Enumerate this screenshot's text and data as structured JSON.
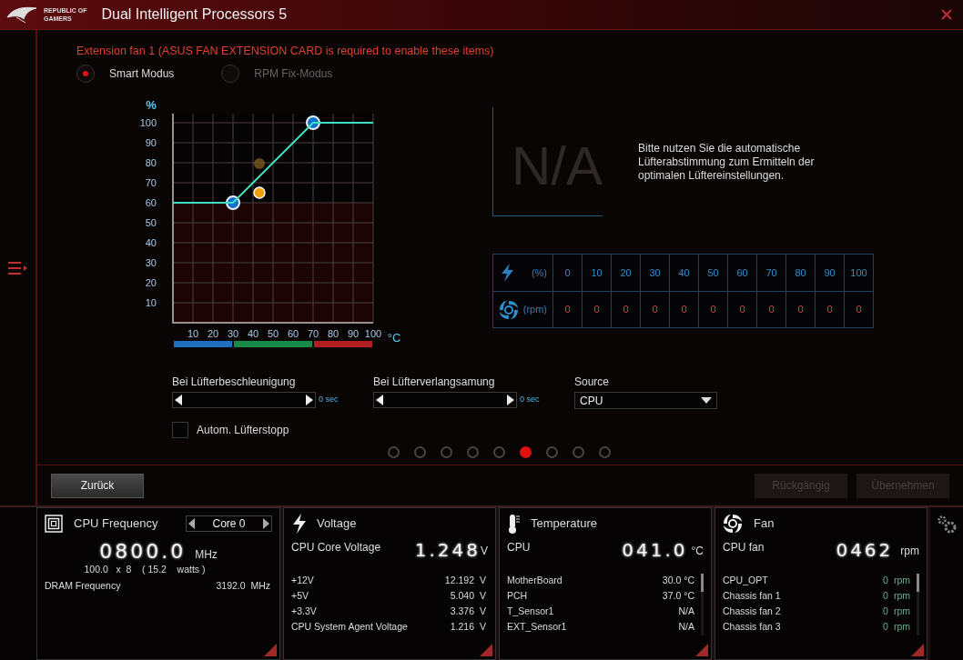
{
  "window": {
    "logo_lines": [
      "REPUBLIC OF",
      "GAMERS"
    ],
    "title": "Dual Intelligent Processors 5"
  },
  "notice": "Extension fan 1 (ASUS FAN EXTENSION CARD is required to enable these items)",
  "modes": [
    {
      "label": "Smart Modus",
      "selected": true,
      "disabled": false
    },
    {
      "label": "RPM Fix-Modus",
      "selected": false,
      "disabled": true
    }
  ],
  "fan_curve": {
    "chart_data": {
      "type": "line",
      "xlabel": "°C",
      "ylabel": "%",
      "x": [
        0,
        30,
        70,
        100
      ],
      "series": [
        {
          "color": "#3fe0c0",
          "values": [
            60,
            60,
            100,
            100
          ]
        }
      ],
      "xlim": [
        0,
        100
      ],
      "ylim": [
        0,
        100
      ],
      "xticks": [
        10,
        20,
        30,
        40,
        50,
        60,
        70,
        80,
        90,
        100
      ],
      "yticks": [
        10,
        20,
        30,
        40,
        50,
        60,
        70,
        80,
        90,
        100
      ],
      "grid": true,
      "bands": [
        {
          "axis": "y",
          "from": 0,
          "to": 60,
          "color": "#1c0404"
        }
      ]
    }
  },
  "tuning": {
    "reading": "N/A",
    "message": "Bitte nutzen Sie die automatische Lüfterabstimmung zum Ermitteln der optimalen Lüftereinstellungen."
  },
  "table": {
    "rows": [
      {
        "kind": "power",
        "unit": "(%)",
        "values": [
          "0",
          "10",
          "20",
          "30",
          "40",
          "50",
          "60",
          "70",
          "80",
          "90",
          "100"
        ]
      },
      {
        "kind": "fan",
        "unit": "(rpm)",
        "values": [
          "0",
          "0",
          "0",
          "0",
          "0",
          "0",
          "0",
          "0",
          "0",
          "0",
          "0"
        ]
      }
    ]
  },
  "sliders": [
    {
      "label": "Bei Lüfterbeschleunigung",
      "reading": "0 sec"
    },
    {
      "label": "Bei Lüfterverlangsamung",
      "reading": "0 sec"
    }
  ],
  "source": {
    "label": "Source",
    "value": "CPU"
  },
  "autostop": {
    "label": "Autom. Lüfterstopp",
    "checked": false
  },
  "pages": [
    {
      "selected": false
    },
    {
      "selected": false
    },
    {
      "selected": false
    },
    {
      "selected": false
    },
    {
      "selected": false
    },
    {
      "selected": true
    },
    {
      "selected": false
    },
    {
      "selected": false
    },
    {
      "selected": false
    }
  ],
  "buttons": [
    {
      "label": "Zurück",
      "disabled": false
    },
    {
      "label": "Rückgängig",
      "disabled": true
    },
    {
      "label": "Übernehmen",
      "disabled": true
    }
  ],
  "monitor": {
    "cpu_frequency": {
      "title": "CPU Frequency",
      "core": "Core 0",
      "value": "0800.0",
      "unit": "MHz",
      "detail": "100.0   x  8    ( 15.2    watts )",
      "dram_label": "DRAM Frequency",
      "dram_value": "3192.0  MHz"
    },
    "voltage": {
      "title": "Voltage",
      "main_label": "CPU Core Voltage",
      "value": "1.248",
      "unit": "V",
      "rows": [
        {
          "label": "+12V",
          "value": "12.192",
          "unit": "V"
        },
        {
          "label": "+5V",
          "value": "5.040",
          "unit": "V"
        },
        {
          "label": "+3.3V",
          "value": "3.376",
          "unit": "V"
        },
        {
          "label": "CPU System Agent Voltage",
          "value": "1.216",
          "unit": "V"
        }
      ]
    },
    "temperature": {
      "title": "Temperature",
      "main_label": "CPU",
      "value": "041.0",
      "unit": "°C",
      "rows": [
        {
          "label": "MotherBoard",
          "value": "30.0 °C"
        },
        {
          "label": "PCH",
          "value": "37.0 °C"
        },
        {
          "label": "T_Sensor1",
          "value": "N/A"
        },
        {
          "label": "EXT_Sensor1",
          "value": "N/A"
        }
      ]
    },
    "fan": {
      "title": "Fan",
      "main_label": "CPU fan",
      "value": "0462",
      "unit": "rpm",
      "rows": [
        {
          "label": "CPU_OPT",
          "value": "0",
          "unit": "rpm"
        },
        {
          "label": "Chassis fan 1",
          "value": "0",
          "unit": "rpm"
        },
        {
          "label": "Chassis fan 2",
          "value": "0",
          "unit": "rpm"
        },
        {
          "label": "Chassis fan 3",
          "value": "0",
          "unit": "rpm"
        }
      ]
    }
  }
}
